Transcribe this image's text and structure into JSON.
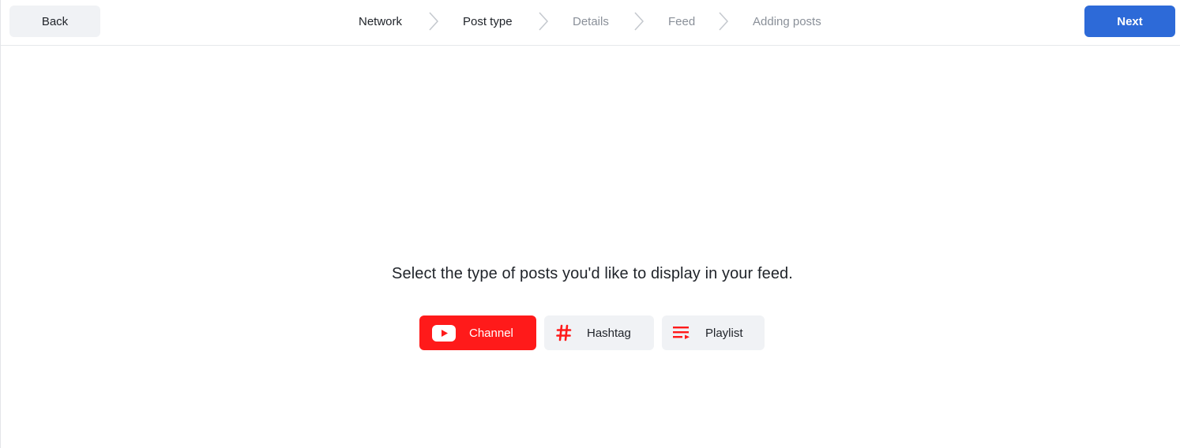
{
  "header": {
    "back_label": "Back",
    "next_label": "Next",
    "steps": [
      {
        "label": "Network",
        "state": "done"
      },
      {
        "label": "Post type",
        "state": "current"
      },
      {
        "label": "Details",
        "state": "upcoming"
      },
      {
        "label": "Feed",
        "state": "upcoming"
      },
      {
        "label": "Adding posts",
        "state": "upcoming"
      }
    ]
  },
  "main": {
    "prompt": "Select the type of posts you'd like to display in your feed.",
    "post_types": [
      {
        "label": "Channel",
        "icon": "youtube-icon",
        "selected": true
      },
      {
        "label": "Hashtag",
        "icon": "hashtag-icon",
        "selected": false
      },
      {
        "label": "Playlist",
        "icon": "playlist-icon",
        "selected": false
      }
    ]
  },
  "colors": {
    "accent_blue": "#2d6ad8",
    "youtube_red": "#ff1a1a",
    "button_gray": "#f0f2f5",
    "text_dark": "#1f2329",
    "text_muted": "#8a9099"
  }
}
